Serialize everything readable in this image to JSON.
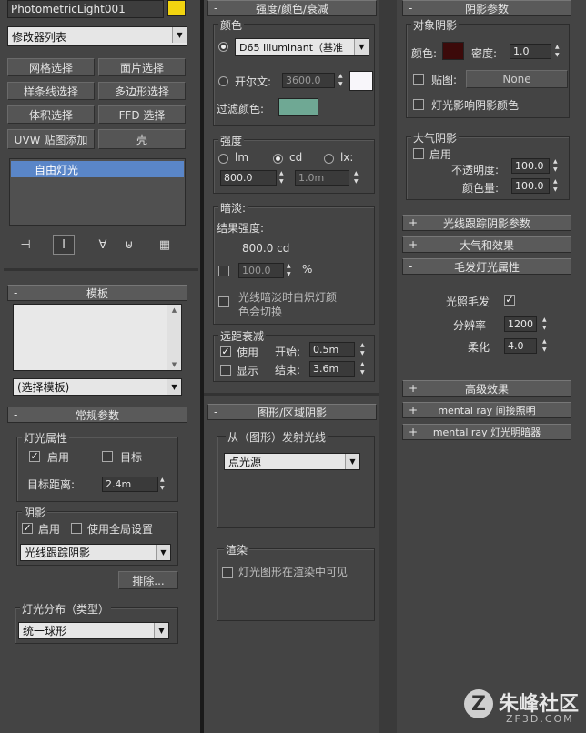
{
  "object_name": "PhotometricLight001",
  "object_color": "#f2d410",
  "modifier_list": "修改器列表",
  "modifier_buttons": [
    "网格选择",
    "面片选择",
    "样条线选择",
    "多边形选择",
    "体积选择",
    "FFD 选择",
    "UVW 贴图添加",
    "壳"
  ],
  "modifier_stack_item": "自由灯光",
  "templates": {
    "title": "模板",
    "select": "(选择模板)"
  },
  "general": {
    "title": "常规参数",
    "light_props": "灯光属性",
    "enabled": "启用",
    "target": "目标",
    "target_dist_label": "目标距离:",
    "target_dist": "2.4m",
    "shadows": "阴影",
    "shadow_on": "启用",
    "use_global": "使用全局设置",
    "shadow_type": "光线跟踪阴影",
    "exclude": "排除...",
    "distribution_label": "灯光分布（类型）",
    "distribution": "统一球形"
  },
  "intensity": {
    "title": "强度/颜色/衰减",
    "color_label": "颜色",
    "illuminant": "D65 Illuminant（基准",
    "kelvin_label": "开尔文:",
    "kelvin": "3600.0",
    "filter_label": "过滤颜色:",
    "filter_color": "#6fa894",
    "strength_label": "强度",
    "unit_lm": "lm",
    "unit_cd": "cd",
    "unit_lx": "lx:",
    "value": "800.0",
    "dist": "1.0m",
    "dim_label": "暗淡:",
    "result_label": "结果强度:",
    "result": "800.0 cd",
    "percent": "100.0",
    "pct": "%",
    "incand_1": "光线暗淡时白炽灯颜",
    "incand_2": "色会切换",
    "far_label": "远距衰减",
    "use": "使用",
    "show": "显示",
    "start_label": "开始:",
    "start": "0.5m",
    "end_label": "结束:",
    "end": "3.6m"
  },
  "shape": {
    "title": "图形/区域阴影",
    "emit_label": "从（图形）发射光线",
    "emit": "点光源",
    "render_label": "渲染",
    "render_vis": "灯光图形在渲染中可见"
  },
  "shadow_params": {
    "title": "阴影参数",
    "object_shadow": "对象阴影",
    "color_label": "颜色:",
    "color": "#3c0a0a",
    "density_label": "密度:",
    "density": "1.0",
    "map_label": "贴图:",
    "map": "None",
    "affect": "灯光影响阴影颜色",
    "atmos_label": "大气阴影",
    "atmos_on": "启用",
    "opacity_label": "不透明度:",
    "opacity": "100.0",
    "amount_label": "颜色量:",
    "amount": "100.0"
  },
  "rollouts": [
    "光线跟踪阴影参数",
    "大气和效果",
    "毛发灯光属性"
  ],
  "hair": {
    "light_hair": "光照毛发",
    "res_label": "分辨率",
    "res": "1200",
    "soft_label": "柔化",
    "soft": "4.0"
  },
  "rollouts2": [
    "高级效果",
    "mental ray 间接照明",
    "mental ray 灯光明暗器"
  ],
  "watermark": {
    "brand": "朱峰社区",
    "url": "ZF3D.COM"
  }
}
